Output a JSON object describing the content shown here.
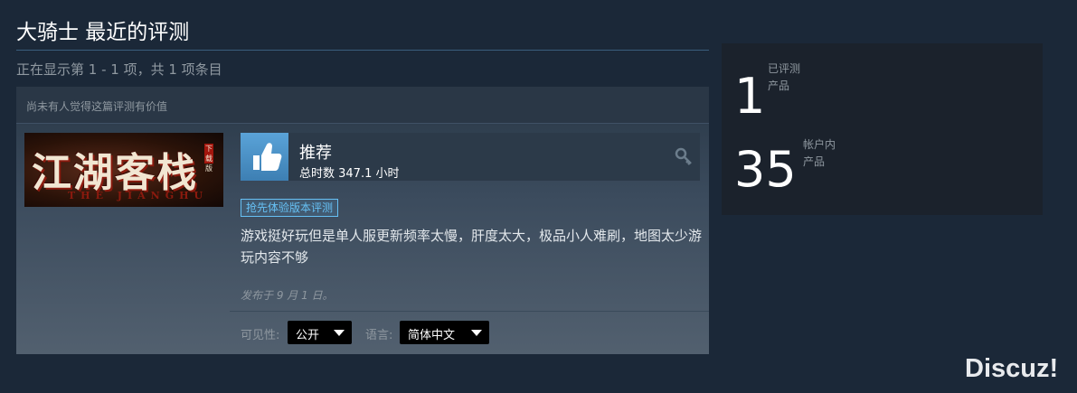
{
  "page": {
    "title": "大骑士 最近的评测",
    "showing": "正在显示第 1 - 1 项，共 1 项条目"
  },
  "review": {
    "helpful_text": "尚未有人觉得这篇评测有价值",
    "game_art": {
      "main_text": "江湖客栈",
      "sub_text": "THE JIANGHU",
      "stamp": "下载版"
    },
    "verdict": "推荐",
    "hours": "总时数 347.1 小时",
    "early_access_badge": "抢先体验版本评测",
    "text": "游戏挺好玩但是单人服更新频率太慢，肝度太大，极品小人难刷，地图太少游玩内容不够",
    "posted": "发布于 9 月 1 日。",
    "visibility_label": "可见性:",
    "visibility_value": "公开",
    "language_label": "语言:",
    "language_value": "简体中文",
    "icons": {
      "thumb": "thumbs-up-icon",
      "key": "key-icon"
    }
  },
  "stats": {
    "reviewed_count": "1",
    "reviewed_label_1": "已评测",
    "reviewed_label_2": "产品",
    "owned_count": "35",
    "owned_label_1": "帐户内",
    "owned_label_2": "产品"
  },
  "watermark": "Discuz!",
  "colors": {
    "background": "#1b2838",
    "accent": "#66c0f4",
    "thumb": "#4a8fc4"
  }
}
